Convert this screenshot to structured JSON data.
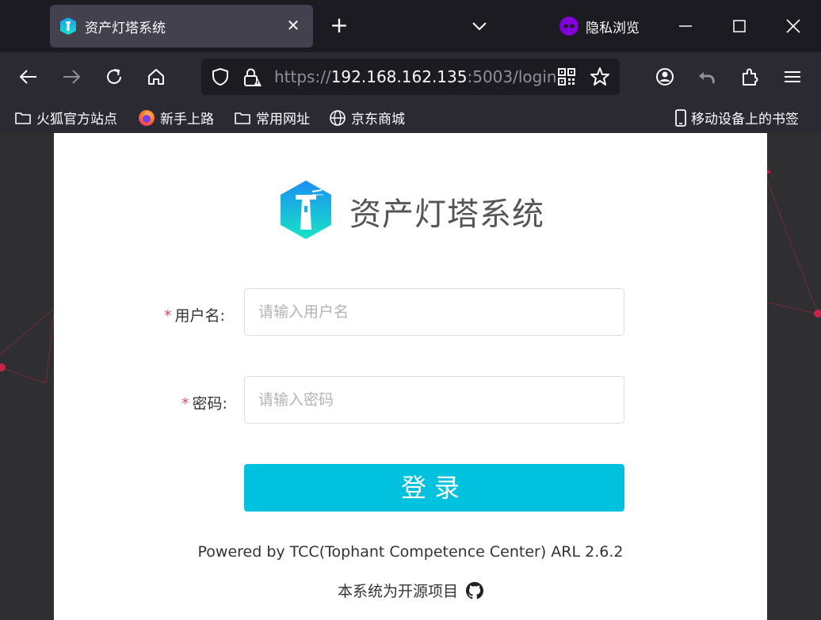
{
  "browser": {
    "tab": {
      "title": "资产灯塔系统",
      "close_glyph": "✕"
    },
    "newtab_glyph": "+",
    "private_label": "隐私浏览",
    "url": {
      "scheme": "https://",
      "host": "192.168.162.135",
      "rest": ":5003/login"
    },
    "icons": [
      "back-icon",
      "forward-icon",
      "reload-icon",
      "home-icon",
      "shield-icon",
      "lock-icon",
      "qr-code-icon",
      "star-icon",
      "account-icon",
      "undo-icon",
      "extensions-icon",
      "menu-icon"
    ]
  },
  "bookmarks": {
    "items": [
      {
        "label": "火狐官方站点",
        "icon": "folder-icon"
      },
      {
        "label": "新手上路",
        "icon": "firefox-icon"
      },
      {
        "label": "常用网址",
        "icon": "folder-icon"
      },
      {
        "label": "京东商城",
        "icon": "globe-icon"
      }
    ],
    "mobile": {
      "label": "移动设备上的书签",
      "icon": "mobile-icon"
    }
  },
  "login": {
    "app_title": "资产灯塔系统",
    "username": {
      "label": "用户名:",
      "placeholder": "请输入用户名",
      "required_mark": "*"
    },
    "password": {
      "label": "密码:",
      "placeholder": "请输入密码",
      "required_mark": "*"
    },
    "submit_label": "登录",
    "powered_by": "Powered by TCC(Tophant Competence Center) ARL 2.6.2",
    "open_source_text": "本系统为开源项目",
    "colors": {
      "accent": "#00c1de",
      "required": "#e74c5e"
    }
  }
}
